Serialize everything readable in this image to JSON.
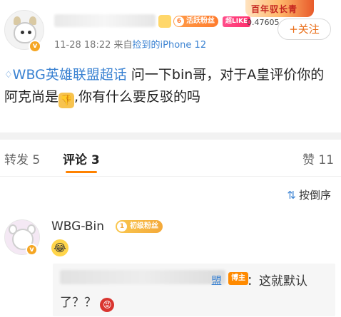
{
  "post": {
    "time": "11-28 18:22",
    "source_prefix": "来自",
    "device": "捡到的iPhone 12",
    "fan_level": "6",
    "fan_badge": "活跃粉丝",
    "super_like": "超LIKE",
    "promo": "百年驭长青",
    "number_strip": "0.47605",
    "follow": "+关注",
    "topic_diamond": "♢",
    "topic": "WBG英雄联盟超话",
    "text_part1": " 问一下bin哥，对于A皇评价你的阿克尚是",
    "thumb_emoji": "👎",
    "text_part2": ",你有什么要反驳的吗"
  },
  "tabs": {
    "repost": "转发 5",
    "comment": "评论 3",
    "like": "赞 11"
  },
  "sort": {
    "icon": "⇅",
    "label": "按倒序"
  },
  "comment": {
    "name": "WBG-Bin",
    "badge_level": "1",
    "badge": "初级粉丝",
    "emoji": "😂",
    "reply": {
      "name_tail": "盟",
      "host_badge": "博主",
      "text_line1": "：这就默认",
      "text_line2": "了？？",
      "emoji": "😡"
    }
  },
  "verified_mark": "v",
  "colors": {
    "accent": "#ff8200",
    "link": "#3a82d2",
    "divider": "#f2f2f2"
  }
}
